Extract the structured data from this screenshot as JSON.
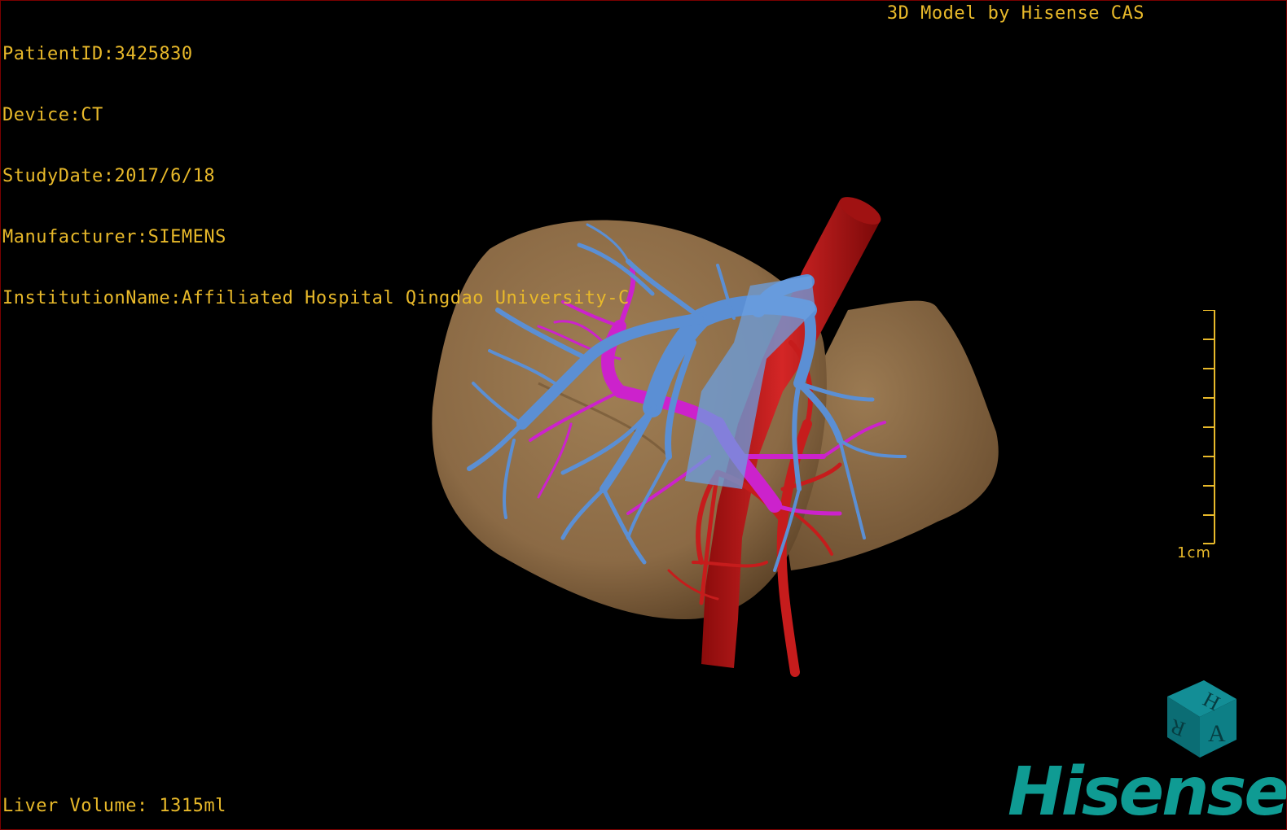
{
  "header": {
    "patient_id": "PatientID:3425830",
    "device": "Device:CT",
    "study_date": "StudyDate:2017/6/18",
    "manufacturer": "Manufacturer:SIEMENS",
    "institution": "InstitutionName:Affiliated Hospital Qingdao University-C"
  },
  "credit": "3D Model by Hisense CAS",
  "footer": {
    "liver_volume": "Liver Volume: 1315ml"
  },
  "scale": {
    "label": "1cm"
  },
  "orientation_cube": {
    "faces": [
      "H",
      "R",
      "A"
    ]
  },
  "brand": "Hisense",
  "colors": {
    "text": "#e8b92a",
    "liver": "#8b6a45",
    "portal_vein": "#5b8fd4",
    "hepatic_artery": "#c61c1c",
    "hepatic_vein": "#cc22cc",
    "brand": "#0f9b93",
    "cube": "#0d7f86"
  }
}
